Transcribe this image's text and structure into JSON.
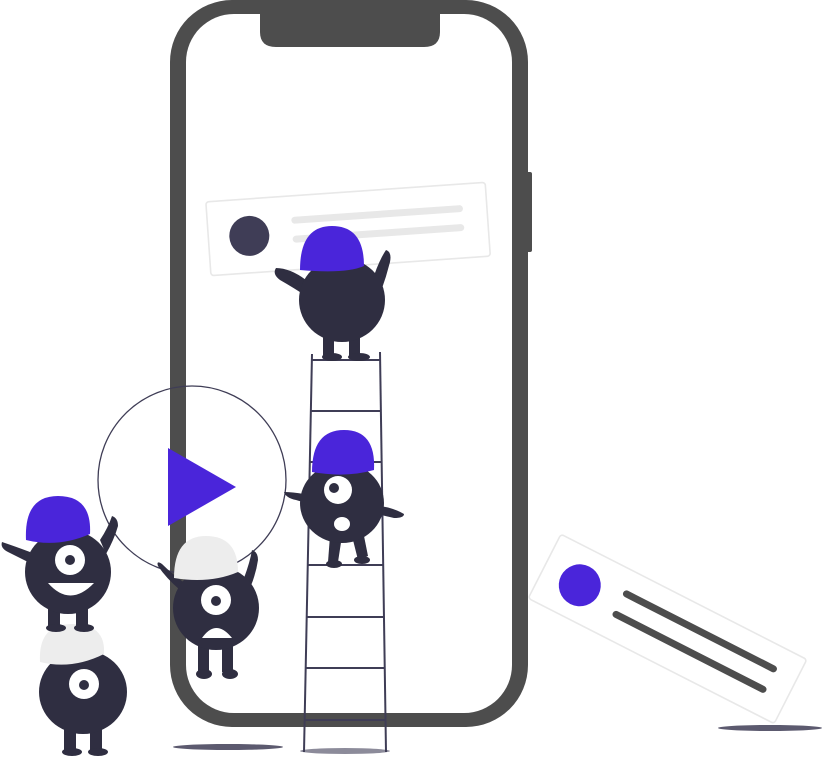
{
  "illustration": {
    "colors": {
      "accent": "#4A25DA",
      "phone_frame": "#4D4D4D",
      "screen": "#FFFFFF",
      "monster_body": "#2F2E41",
      "hat_gray": "#EDEDED",
      "card_line": "#E8E8E8",
      "card_avatar_dark": "#3F3D56",
      "outline": "#3F3D56"
    },
    "icons": {
      "play": "play-icon",
      "ladder": "ladder",
      "phone": "smartphone",
      "card": "notification-card",
      "monster": "monster-character"
    }
  }
}
